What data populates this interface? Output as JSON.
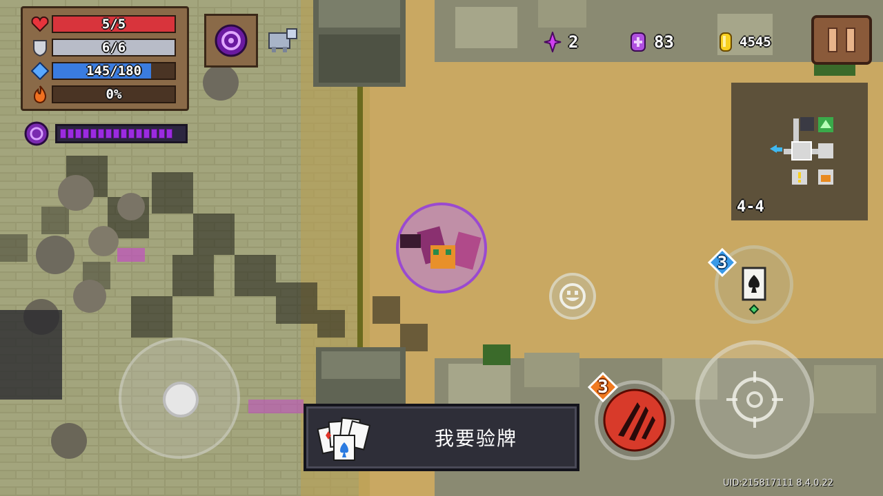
{
  "player_status": {
    "health": {
      "text": "5/5",
      "fraction": 1.0,
      "color": "#d8343c"
    },
    "armor": {
      "text": "6/6",
      "fraction": 1.0,
      "color": "#b8bcc8"
    },
    "energy": {
      "text": "145/180",
      "fraction": 0.806,
      "color": "#3a7ce0"
    },
    "crit": {
      "text": "0%",
      "fraction": 0.0,
      "color": "#e86a20"
    }
  },
  "skill_charge": {
    "filled_segments": 15,
    "color": "#9b2be0"
  },
  "currencies": {
    "gems": {
      "value": "2"
    },
    "materials": {
      "value": "83"
    },
    "gold": {
      "value": "4545"
    }
  },
  "level": {
    "label": "4-4"
  },
  "weapon_popup": {
    "name": "我要验牌"
  },
  "weapon_swap": {
    "count": "3"
  },
  "skill_button": {
    "count": "3"
  },
  "uid_version": "UID:215817111 8.4.0.22",
  "icons": [
    "heart-icon",
    "shield-icon",
    "energy-crystal-icon",
    "flame-icon",
    "skill-portrait-icon",
    "pet-icon",
    "gem-icon",
    "material-coin-icon",
    "gold-coin-icon",
    "pause-icon",
    "smiley-icon",
    "spade-card-icon",
    "crosshair-icon",
    "claw-skill-icon",
    "playing-cards-icon"
  ]
}
